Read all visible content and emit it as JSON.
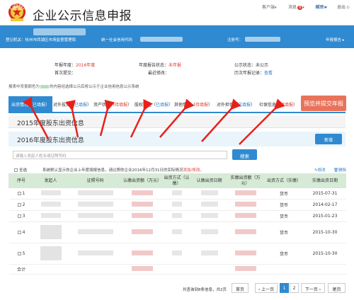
{
  "header": {
    "title": "企业公示信息申报",
    "links": [
      "客户端",
      "消息",
      "帮助",
      "退出"
    ],
    "msg_count": "9",
    "colors": {
      "primary": "#2f8ad1",
      "accent_red": "#e03b2c"
    }
  },
  "welcome": {
    "greeting": "欢迎您！",
    "reg_org_label": "登记机关：",
    "reg_org_value": "杭州市西湖区市场监督管理局",
    "credit_code_label": "统一社会信用代码",
    "reg_no_label": "注册号：",
    "report_label": "年报报告"
  },
  "status": {
    "year_label": "年报年度：",
    "year_value": "2016年度",
    "state_label": "年度报告状态：",
    "state_value": "未年报",
    "public_label": "公示状态：",
    "public_value": "未公示",
    "first_submit_label": "首次提交：",
    "last_modify_label": "最近修改：",
    "history_label": "历次年报记录：",
    "history_link": "查看"
  },
  "notice": {
    "prefix": "报表中背景颜色为",
    "suffix": "的内容经选择公示后将公示于企业信用信息公示系统"
  },
  "tabs": [
    {
      "label": "出资情况",
      "state": "已填报",
      "active": true
    },
    {
      "label": "对外投资",
      "state": "已填报"
    },
    {
      "label": "资产状况",
      "state": "待填报"
    },
    {
      "label": "股权转让",
      "state": "已填报"
    },
    {
      "label": "其他情况",
      "state": "待填报"
    },
    {
      "label": "对外担保",
      "state": "已填报"
    },
    {
      "label": "社保信息",
      "state": "待填报"
    }
  ],
  "preview_button": "预览并提交年报",
  "year_2015": {
    "title": "2015年度股东出资信息",
    "expand": "展开"
  },
  "year_2016": {
    "title": "2016年度股东出资信息",
    "add": "新增"
  },
  "search": {
    "placeholder": "请输入发起人姓名或证照号码",
    "button": "搜索"
  },
  "select_all": "全选",
  "hint": "系统默认显示你企业上年度填报信息，请比照你企业2016年12月31日的实际情况",
  "hint_link": "添加/修改。",
  "edit": "修改",
  "delete": "删除",
  "table": {
    "headers": [
      "序号",
      "发起人",
      "证照号码",
      "认缴出资额（万元）",
      "出资方式（认缴）",
      "认缴出资日期",
      "实缴出资额（万元）",
      "出资方式（实缴）",
      "实缴出资日期"
    ],
    "rows": [
      {
        "no": "1",
        "method": "货币",
        "date": "2015-07-31"
      },
      {
        "no": "2",
        "method": "货币",
        "date": "2014-02-17"
      },
      {
        "no": "3",
        "method": "货币",
        "date": "2015-01-23"
      },
      {
        "no": "4",
        "method": "货币",
        "date": "2015-10-30"
      },
      {
        "no": "5",
        "method": "货币",
        "date": "2015-10-30"
      }
    ],
    "total_label": "合计"
  },
  "pager": {
    "info": "共查询到8条信息，共2页",
    "first": "首页",
    "prev": "上一页",
    "pages": [
      "1",
      "2"
    ],
    "next": "下一页",
    "last": "尾页"
  }
}
